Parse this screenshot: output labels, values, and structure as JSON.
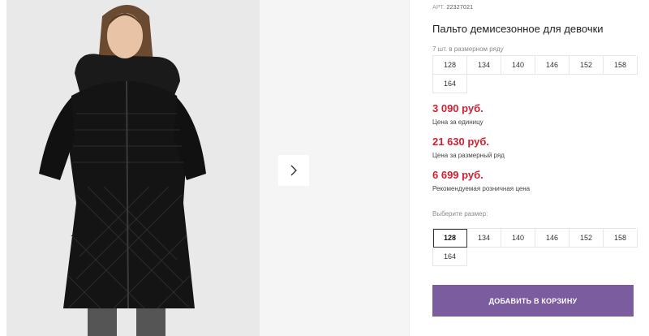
{
  "product": {
    "art_label": "АРТ.",
    "art_number": "22327021",
    "title": "Пальто демисезонное для девочки"
  },
  "gallery": {
    "main_image": "girl-black-quilted-coat-photo",
    "next_icon": "chevron-right-icon"
  },
  "pack": {
    "note": "7 шт. в размерном ряду",
    "sizes": [
      "128",
      "134",
      "140",
      "146",
      "152",
      "158",
      "164"
    ]
  },
  "prices": [
    {
      "amount": "3 090 руб.",
      "label": "Цена за единицу"
    },
    {
      "amount": "21 630 руб.",
      "label": "Цена за размерный ряд"
    },
    {
      "amount": "6 699 руб.",
      "label": "Рекомендуемая розничная цена"
    }
  ],
  "size_select": {
    "label": "Выберите размер:",
    "sizes": [
      "128",
      "134",
      "140",
      "146",
      "152",
      "158",
      "164"
    ],
    "selected": "128"
  },
  "cart": {
    "button_label": "ДОБАВИТЬ В КОРЗИНУ"
  },
  "colors": {
    "price": "#d31f31",
    "cart_button": "#7b5c9f",
    "photo_bg": "#e9e9e9"
  }
}
